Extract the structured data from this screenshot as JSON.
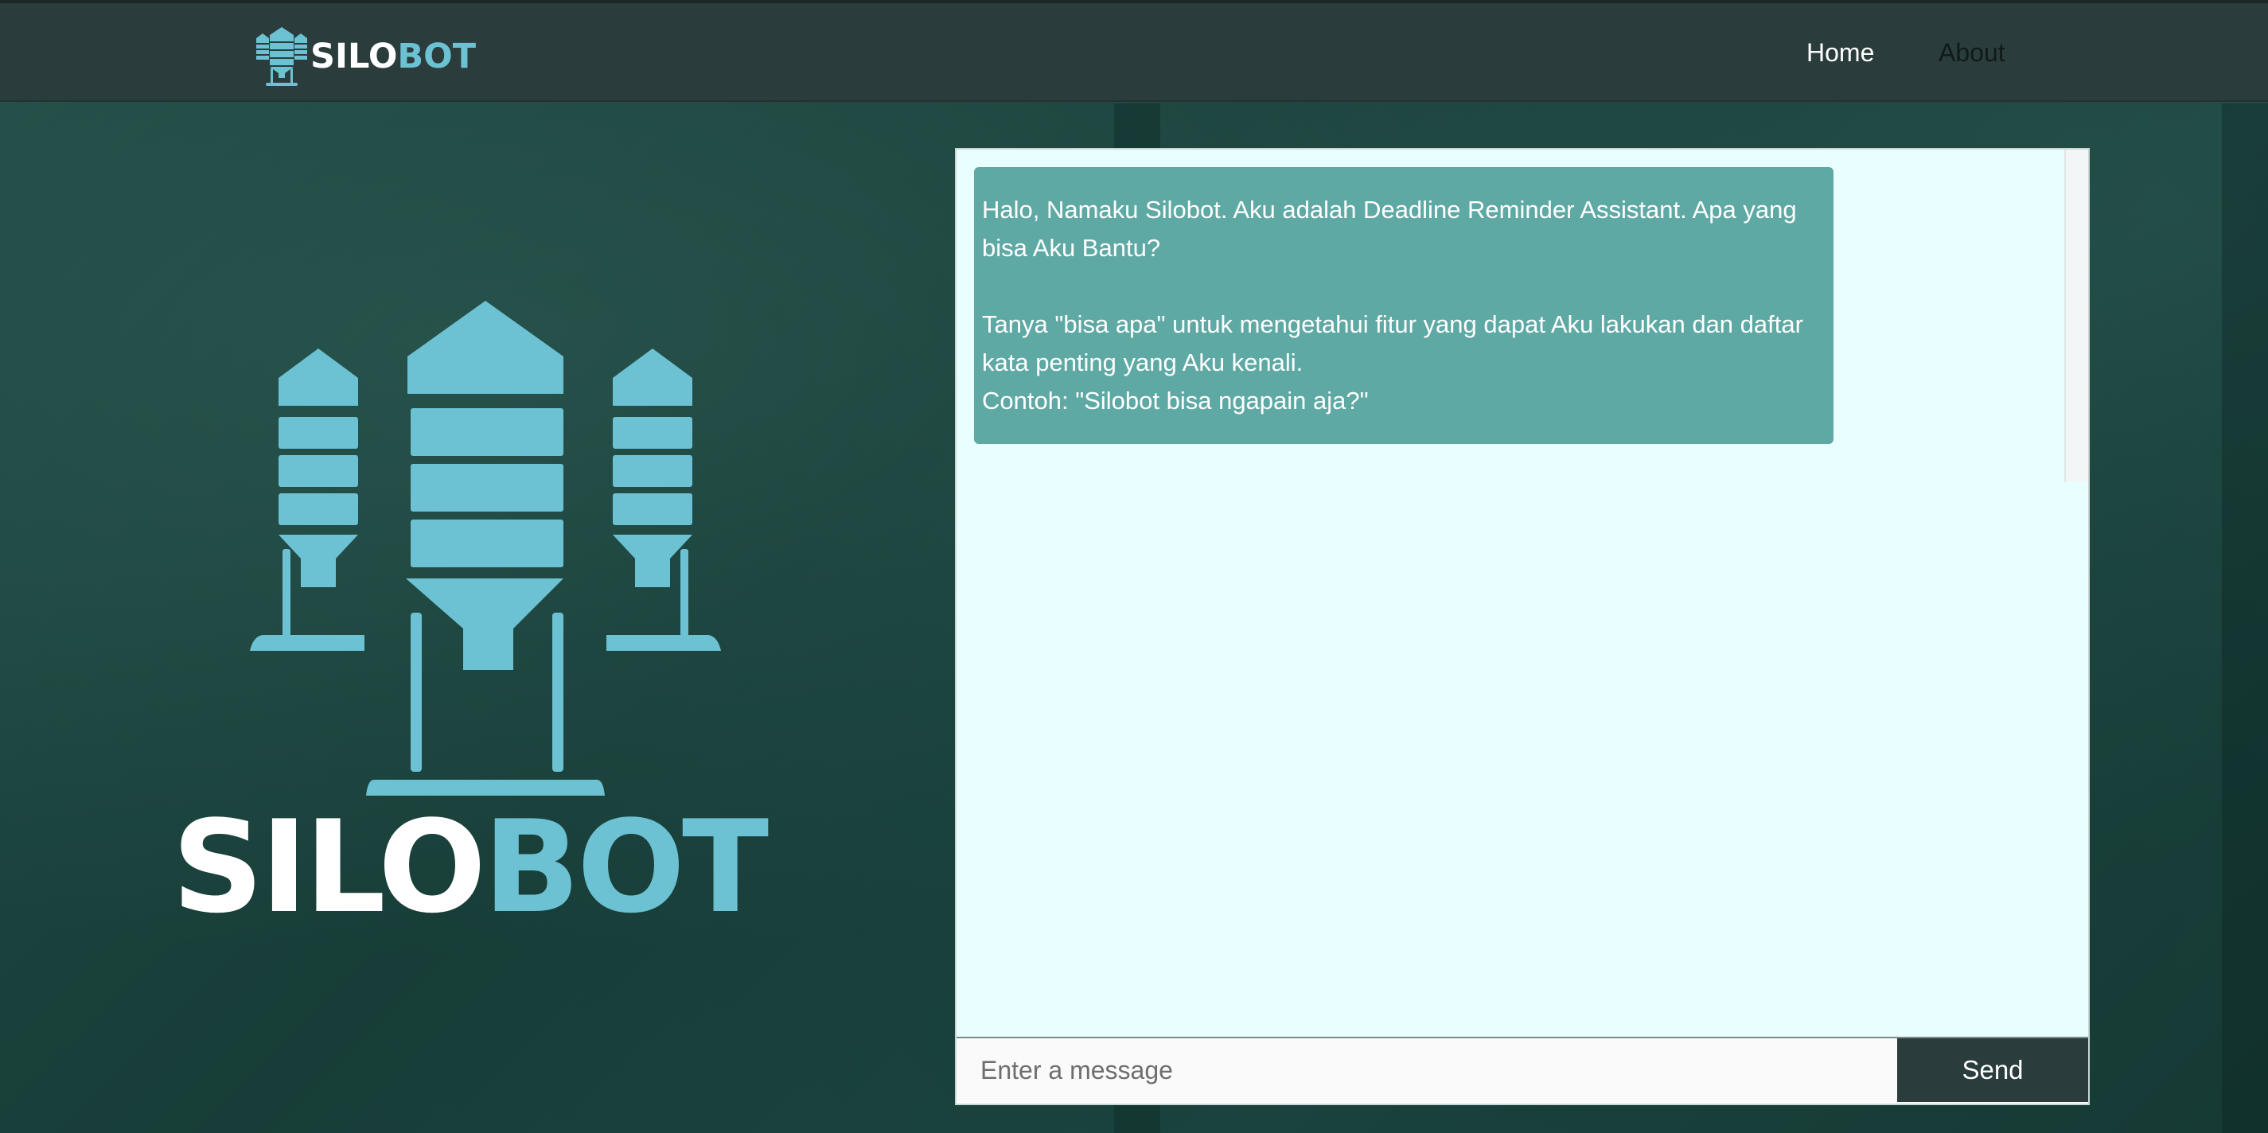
{
  "navbar": {
    "brand_part1": "SILO",
    "brand_part2": "BOT",
    "links": [
      "Home",
      "About"
    ]
  },
  "hero": {
    "brand_part1": "SILO",
    "brand_part2": "BOT"
  },
  "chat": {
    "messages": [
      {
        "sender": "bot",
        "paragraphs": [
          "Halo, Namaku Silobot. Aku adalah Deadline Reminder Assistant. Apa yang bisa Aku Bantu?",
          "Tanya \"bisa apa\" untuk mengetahui fitur yang dapat Aku lakukan dan daftar kata penting yang Aku kenali.",
          "Contoh: \"Silobot bisa ngapain aja?\""
        ]
      }
    ],
    "input_placeholder": "Enter a message",
    "send_label": "Send"
  },
  "colors": {
    "brand_white": "#ffffff",
    "brand_blue": "#6cc1d3",
    "navbar_bg": "#2a3c3c",
    "chat_bg": "#e9fefe",
    "bubble_bg": "#5fa9a5"
  }
}
